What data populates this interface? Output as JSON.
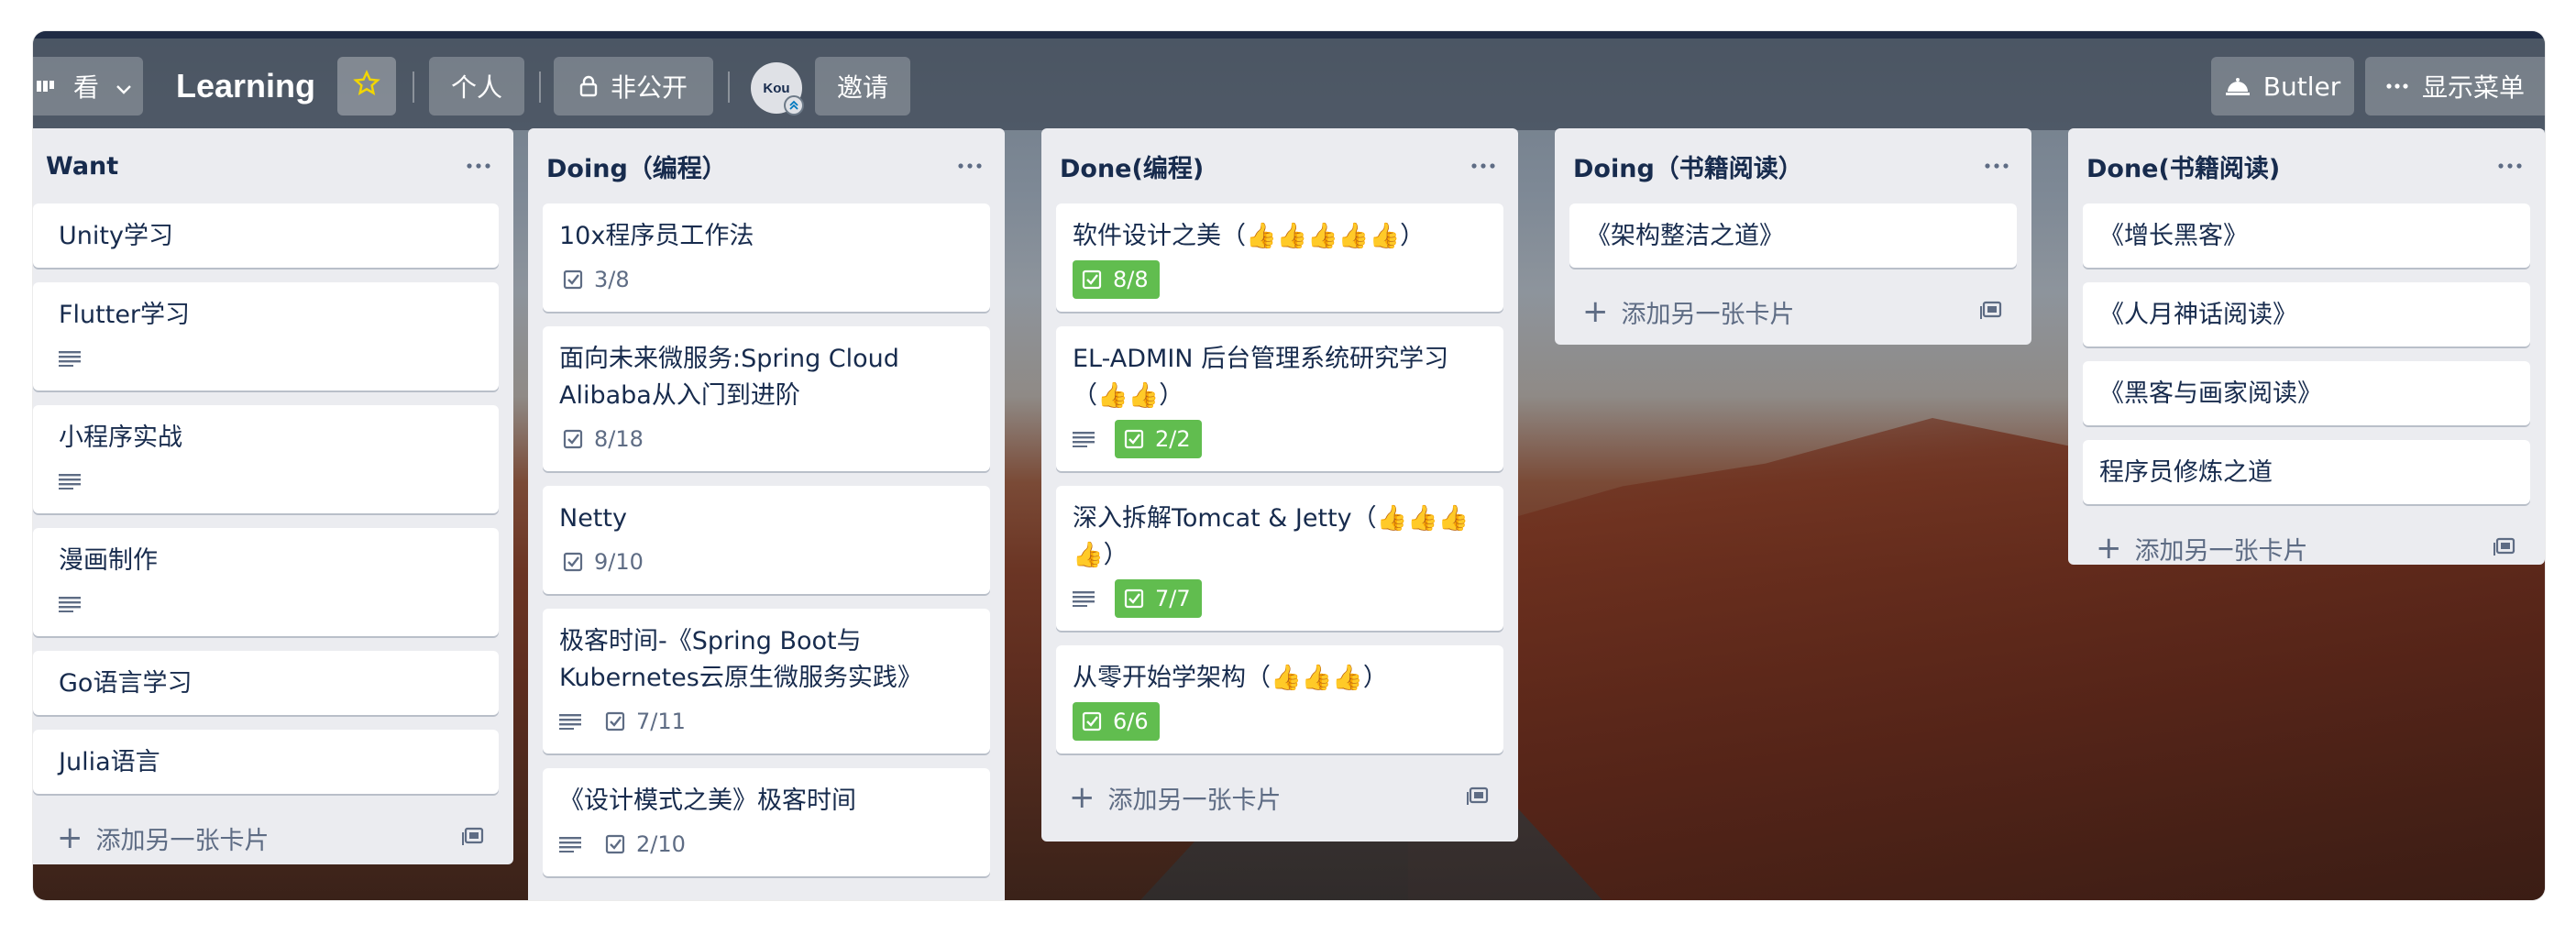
{
  "header": {
    "view_label": "看",
    "board_title": "Learning",
    "personal_label": "个人",
    "visibility_label": "非公开",
    "avatar_initials": "Kou",
    "invite_label": "邀请",
    "butler_label": "Butler",
    "show_menu_label": "显示菜单"
  },
  "colors": {
    "list_bg": "#ebecf0",
    "card_bg": "#ffffff",
    "done_badge": "#61bd4f",
    "text_primary": "#172b4d",
    "text_muted": "#5e6c84"
  },
  "add_card_label": "添加另一张卡片",
  "lists": [
    {
      "title": "Want",
      "cards": [
        {
          "title": "Unity学习"
        },
        {
          "title": "Flutter学习",
          "description": true
        },
        {
          "title": "小程序实战",
          "description": true
        },
        {
          "title": "漫画制作",
          "description": true
        },
        {
          "title": "Go语言学习"
        },
        {
          "title": "Julia语言"
        }
      ]
    },
    {
      "title": "Doing（编程）",
      "cards": [
        {
          "title": "10x程序员工作法",
          "checklist": "3/8"
        },
        {
          "title": "面向未来微服务:Spring Cloud Alibaba从入门到进阶",
          "checklist": "8/18"
        },
        {
          "title": "Netty",
          "checklist": "9/10"
        },
        {
          "title": "极客时间-《Spring Boot与Kubernetes云原生微服务实践》",
          "description": true,
          "checklist": "7/11"
        },
        {
          "title": "《设计模式之美》极客时间",
          "description": true,
          "checklist": "2/10"
        }
      ]
    },
    {
      "title": "Done(编程)",
      "cards": [
        {
          "title": "软件设计之美（👍👍👍👍👍）",
          "checklist": "8/8",
          "complete": true
        },
        {
          "title": "EL-ADMIN 后台管理系统研究学习（👍👍）",
          "description": true,
          "checklist": "2/2",
          "complete": true
        },
        {
          "title": "深入拆解Tomcat & Jetty（👍👍👍👍）",
          "description": true,
          "checklist": "7/7",
          "complete": true
        },
        {
          "title": "从零开始学架构（👍👍👍）",
          "checklist": "6/6",
          "complete": true
        }
      ]
    },
    {
      "title": "Doing（书籍阅读）",
      "cards": [
        {
          "title": "《架构整洁之道》"
        }
      ]
    },
    {
      "title": "Done(书籍阅读)",
      "cards": [
        {
          "title": "《增长黑客》"
        },
        {
          "title": "《人月神话阅读》"
        },
        {
          "title": "《黑客与画家阅读》"
        },
        {
          "title": "程序员修炼之道"
        }
      ]
    }
  ]
}
